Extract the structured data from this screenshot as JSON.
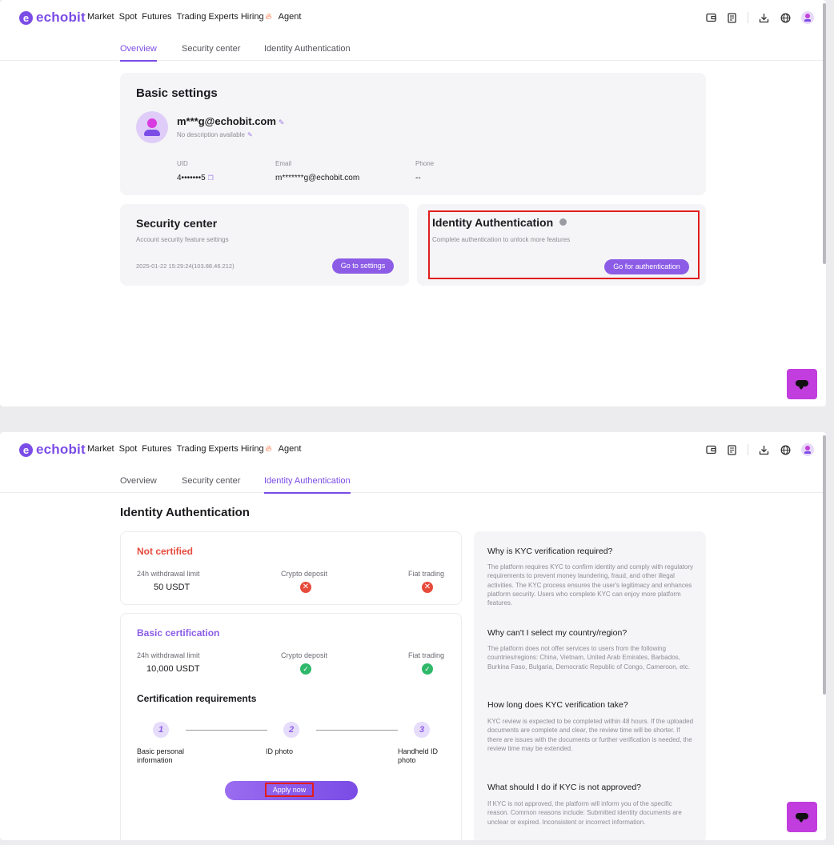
{
  "brand": {
    "name": "echobit",
    "mark": "e"
  },
  "nav": {
    "items": [
      "Market",
      "Spot",
      "Futures",
      "Trading Experts Hiring",
      "Agent"
    ],
    "hot_icon": "fire-icon"
  },
  "top_icons": [
    "wallet-icon",
    "orders-icon",
    "download-icon",
    "globe-icon",
    "user-avatar-icon"
  ],
  "tabs": [
    "Overview",
    "Security center",
    "Identity Authentication"
  ],
  "overview": {
    "basic": {
      "title": "Basic settings",
      "username": "m***g@echobit.com",
      "description": "No description available",
      "uid_label": "UID",
      "uid_value": "4•••••••5",
      "email_label": "Email",
      "email_value": "m*******g@echobit.com",
      "phone_label": "Phone",
      "phone_value": "--"
    },
    "security": {
      "title": "Security center",
      "subtitle": "Account security feature settings",
      "last_login": "2025-01-22 15:29:24(103.88.46.212)",
      "button": "Go to settings"
    },
    "identity": {
      "title": "Identity Authentication",
      "subtitle": "Complete authentication to unlock more features",
      "button": "Go for authentication"
    }
  },
  "identity_page": {
    "heading": "Identity Authentication",
    "not_certified": {
      "title": "Not certified",
      "limit_label": "24h withdrawal limit",
      "limit_value": "50 USDT",
      "crypto_label": "Crypto deposit",
      "fiat_label": "Fiat trading"
    },
    "basic_cert": {
      "title": "Basic certification",
      "limit_label": "24h withdrawal limit",
      "limit_value": "10,000 USDT",
      "crypto_label": "Crypto deposit",
      "fiat_label": "Fiat trading"
    },
    "requirements": {
      "title": "Certification requirements",
      "steps": [
        {
          "num": "1",
          "label": "Basic personal information"
        },
        {
          "num": "2",
          "label": "ID photo"
        },
        {
          "num": "3",
          "label": "Handheld ID photo"
        }
      ],
      "apply_button": "Apply now"
    },
    "faq": [
      {
        "q": "Why is KYC verification required?",
        "a": "The platform requires KYC to confirm identity and comply with regulatory requirements to prevent money laundering, fraud, and other illegal activities. The KYC process ensures the user's legitimacy and enhances platform security. Users who complete KYC can enjoy more platform features."
      },
      {
        "q": "Why can't I select my country/region?",
        "a": "The platform does not offer services to users from the following countries/regions: China, Vietnam, United Arab Emirates, Barbados, Burkina Faso, Bulgaria, Democratic Republic of Congo, Cameroon, etc."
      },
      {
        "q": "How long does KYC verification take?",
        "a": "KYC review is expected to be completed within 48 hours. If the uploaded documents are complete and clear, the review time will be shorter. If there are issues with the documents or further verification is needed, the review time may be extended."
      },
      {
        "q": "What should I do if KYC is not approved?",
        "a": "If KYC is not approved, the platform will inform you of the specific reason. Common reasons include: Submitted identity documents are unclear or expired. Inconsistent or incorrect information."
      }
    ]
  },
  "colors": {
    "accent": "#8c5ce6",
    "brand": "#7b4ce6",
    "danger": "#e64b3c",
    "success": "#2fb86a",
    "highlight": "#e11d1d"
  }
}
